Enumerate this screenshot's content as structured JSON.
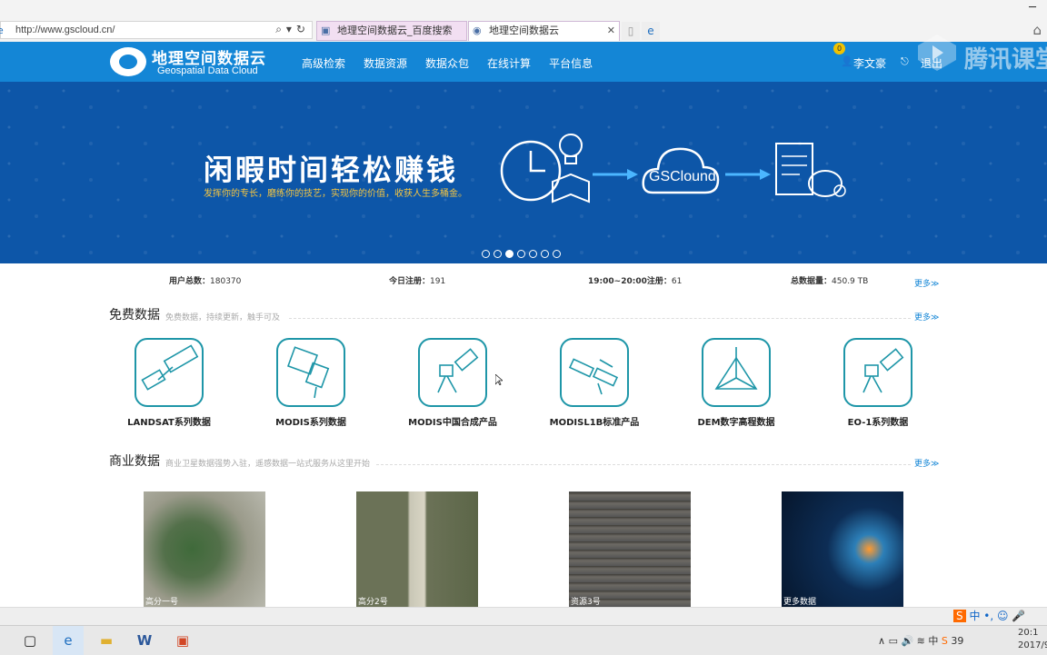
{
  "browser": {
    "url": "http://www.gscloud.cn/",
    "tabs": [
      {
        "title": "地理空间数据云_百度搜索",
        "active": false
      },
      {
        "title": "地理空间数据云",
        "active": true
      }
    ]
  },
  "site": {
    "logo_cn": "地理空间数据云",
    "logo_en": "Geospatial Data Cloud",
    "nav": [
      "高级检索",
      "数据资源",
      "数据众包",
      "在线计算",
      "平台信息"
    ],
    "badge": "0",
    "user": "李文豪",
    "logout": "退出"
  },
  "watermark": "腾讯课堂",
  "banner": {
    "headline": "闲暇时间轻松赚钱",
    "subline": "发挥你的专长，磨练你的技艺，实现你的价值，收获人生多桶金。",
    "cloud_label": "GSClound",
    "slides": 7,
    "active_slide": 3
  },
  "stats": {
    "users_label": "用户总数：",
    "users_value": "180370",
    "today_label": "今日注册：",
    "today_value": "191",
    "hour_label": "19:00~20:00注册：",
    "hour_value": "61",
    "data_label": "总数据量：",
    "data_value": "450.9 TB",
    "more": "更多≫"
  },
  "free_data": {
    "title": "免费数据",
    "subtitle": "免费数据，持续更新，触手可及",
    "more": "更多≫",
    "items": [
      "LANDSAT系列数据",
      "MODIS系列数据",
      "MODIS中国合成产品",
      "MODISL1B标准产品",
      "DEM数字高程数据",
      "EO-1系列数据"
    ]
  },
  "commercial_data": {
    "title": "商业数据",
    "subtitle": "商业卫星数据强势入驻，遥感数据一站式服务从这里开始",
    "more": "更多≫",
    "items": [
      "高分一号",
      "高分2号",
      "资源3号",
      "更多数据"
    ]
  },
  "taskbar": {
    "ime": "中",
    "temp": "39",
    "time": "20:1",
    "date": "2017/9"
  }
}
